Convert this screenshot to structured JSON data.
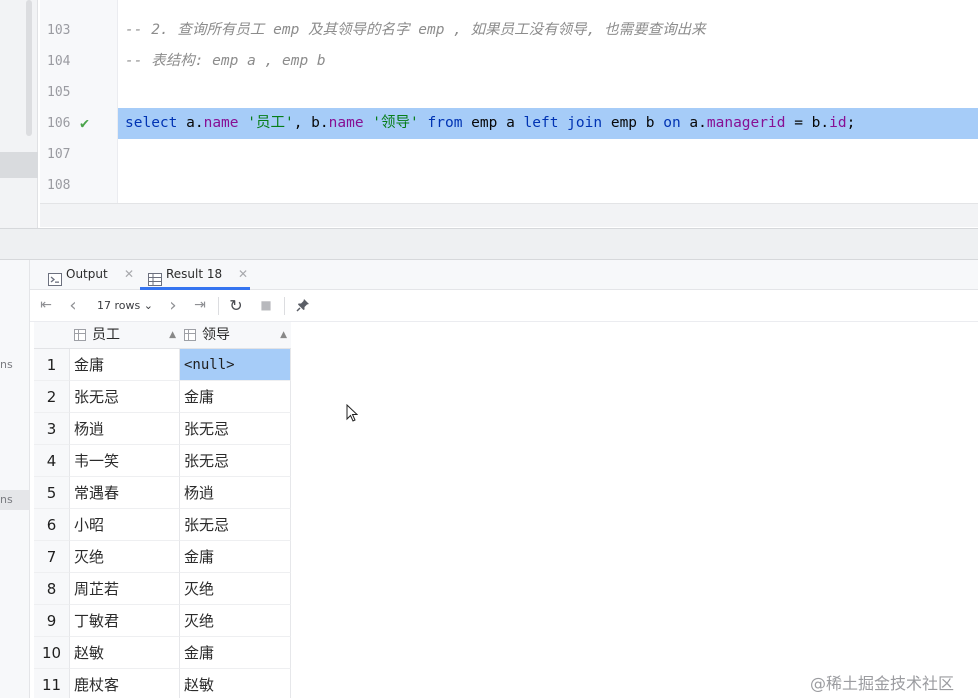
{
  "editor": {
    "lines": [
      {
        "num": "103",
        "kind": "comment",
        "text": "-- 2. 查询所有员工 emp 及其领导的名字 emp , 如果员工没有领导, 也需要查询出来"
      },
      {
        "num": "104",
        "kind": "comment",
        "text": "-- 表结构: emp a , emp b"
      },
      {
        "num": "105",
        "kind": "empty",
        "text": ""
      },
      {
        "num": "106",
        "kind": "sql",
        "executed": true,
        "text": "select a.name '员工', b.name '领导' from emp a left join emp b on a.managerid = b.id;"
      },
      {
        "num": "107",
        "kind": "empty",
        "text": ""
      },
      {
        "num": "108",
        "kind": "empty",
        "text": ""
      }
    ],
    "sql_tokens": [
      {
        "t": "select",
        "c": "kw"
      },
      {
        "t": " a.",
        "c": "plain"
      },
      {
        "t": "name",
        "c": "fld"
      },
      {
        "t": " ",
        "c": "plain"
      },
      {
        "t": "'员工'",
        "c": "str"
      },
      {
        "t": ", b.",
        "c": "plain"
      },
      {
        "t": "name",
        "c": "fld"
      },
      {
        "t": " ",
        "c": "plain"
      },
      {
        "t": "'领导'",
        "c": "str"
      },
      {
        "t": " ",
        "c": "plain"
      },
      {
        "t": "from",
        "c": "kw"
      },
      {
        "t": " emp a ",
        "c": "plain"
      },
      {
        "t": "left join",
        "c": "kw"
      },
      {
        "t": " emp b ",
        "c": "plain"
      },
      {
        "t": "on",
        "c": "kw"
      },
      {
        "t": " a.",
        "c": "plain"
      },
      {
        "t": "managerid",
        "c": "fld"
      },
      {
        "t": " = b.",
        "c": "plain"
      },
      {
        "t": "id",
        "c": "fld"
      },
      {
        "t": ";",
        "c": "plain"
      }
    ]
  },
  "side_fragments": {
    "first": "ns",
    "second": "ns"
  },
  "tabs": [
    {
      "label": "Output",
      "icon": "output-console-icon",
      "active": false
    },
    {
      "label": "Result 18",
      "icon": "table-grid-icon",
      "active": true
    }
  ],
  "toolbar": {
    "first_icon": "⇤",
    "prev_icon": "‹",
    "rows_label": "17 rows ⌄",
    "next_icon": "›",
    "last_icon": "⇥",
    "refresh_icon": "↻",
    "stop_icon": "■",
    "pin_icon": "📌"
  },
  "grid": {
    "columns": [
      "员工",
      "领导"
    ],
    "rows": [
      {
        "n": "1",
        "employee": "金庸",
        "leader": "<null>"
      },
      {
        "n": "2",
        "employee": "张无忌",
        "leader": "金庸"
      },
      {
        "n": "3",
        "employee": "杨逍",
        "leader": "张无忌"
      },
      {
        "n": "4",
        "employee": "韦一笑",
        "leader": "张无忌"
      },
      {
        "n": "5",
        "employee": "常遇春",
        "leader": "杨逍"
      },
      {
        "n": "6",
        "employee": "小昭",
        "leader": "张无忌"
      },
      {
        "n": "7",
        "employee": "灭绝",
        "leader": "金庸"
      },
      {
        "n": "8",
        "employee": "周芷若",
        "leader": "灭绝"
      },
      {
        "n": "9",
        "employee": "丁敏君",
        "leader": "灭绝"
      },
      {
        "n": "10",
        "employee": "赵敏",
        "leader": "金庸"
      },
      {
        "n": "11",
        "employee": "鹿杖客",
        "leader": "赵敏"
      }
    ]
  },
  "watermark": "@稀土掘金技术社区",
  "colors": {
    "selection": "#a6ccf8",
    "keyword": "#0033b3",
    "string": "#067d17",
    "field": "#871094",
    "comment": "#8c8c8c",
    "tab_underline": "#3574f0"
  }
}
